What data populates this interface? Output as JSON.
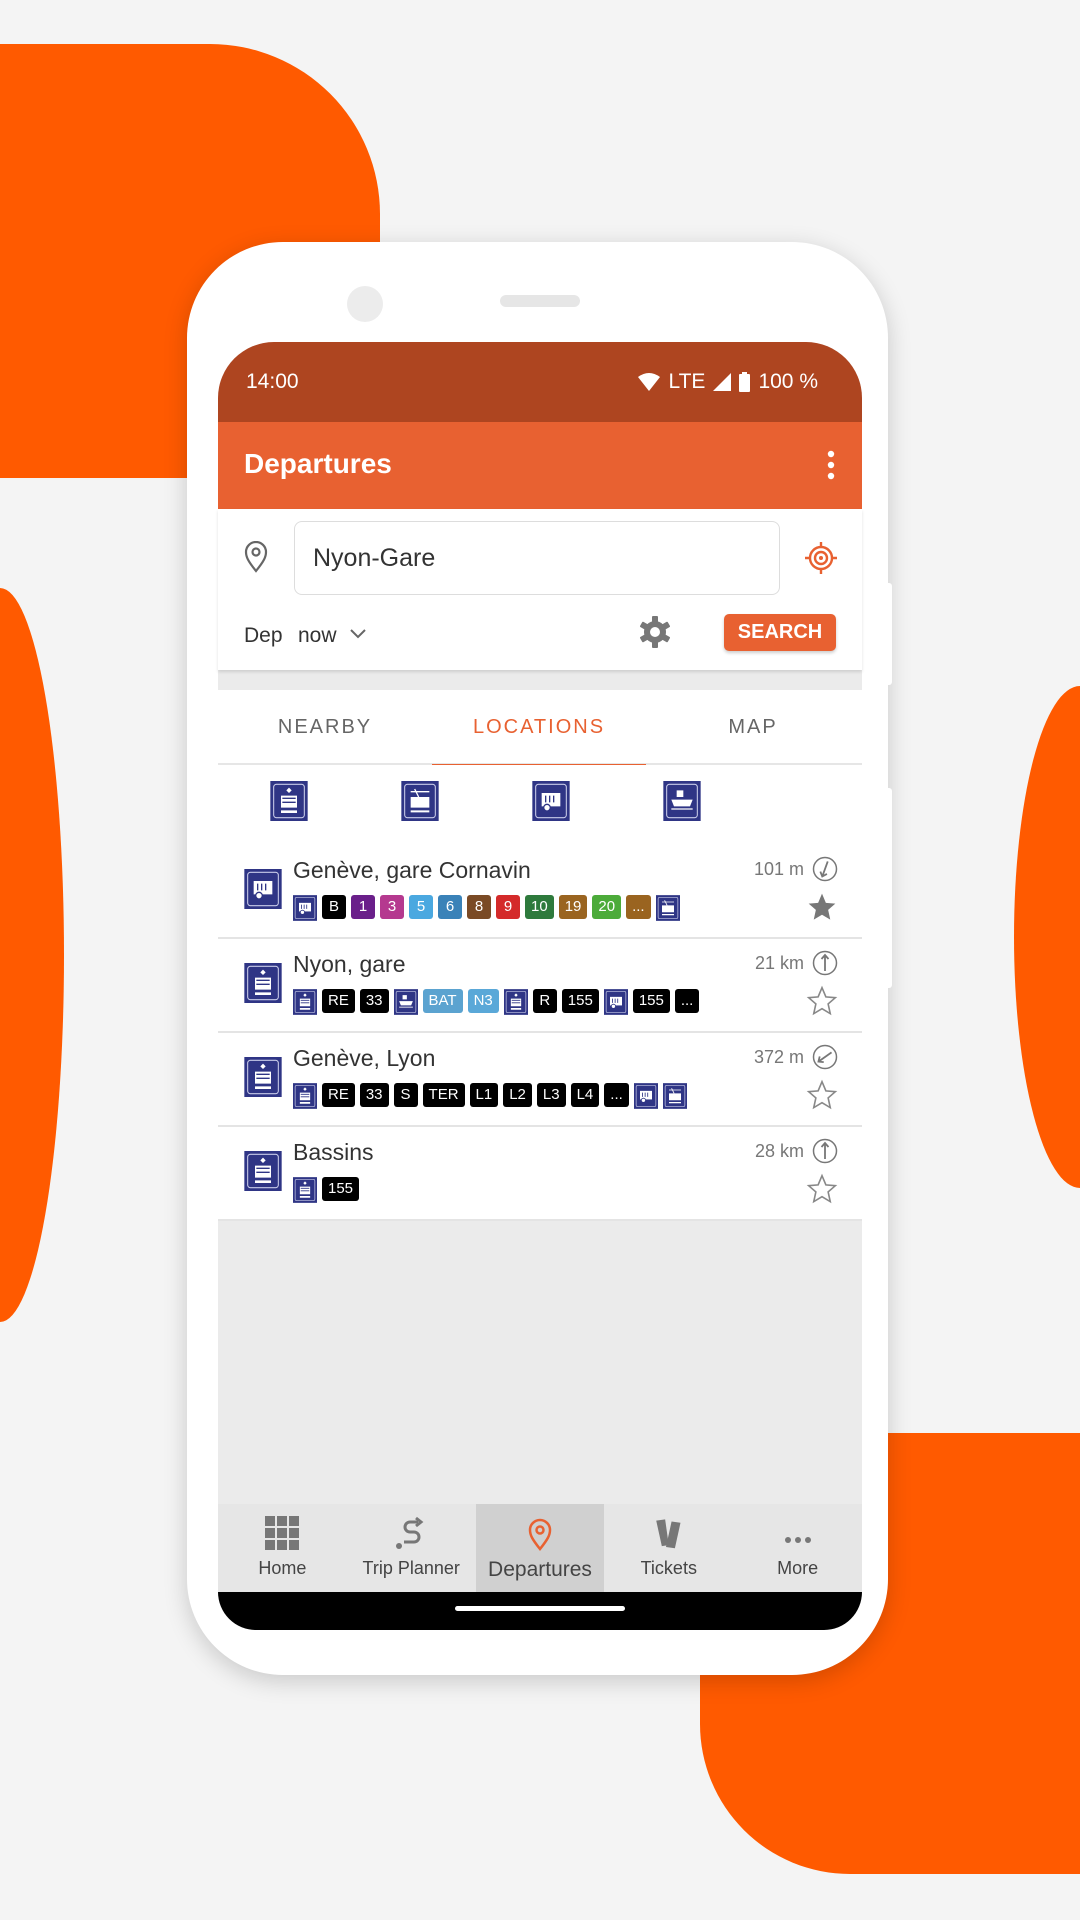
{
  "colors": {
    "brand": "#e86131",
    "status_bar": "#ae4520",
    "background_accent": "#ff5a00",
    "transit_icon": "#2f3585"
  },
  "status_bar": {
    "time": "14:00",
    "network": "LTE",
    "battery": "100 %"
  },
  "app_bar": {
    "title": "Departures"
  },
  "search": {
    "location_value": "Nyon-Gare",
    "dep_label": "Dep",
    "time_value": "now",
    "search_label": "SEARCH"
  },
  "tabs": [
    {
      "label": "NEARBY"
    },
    {
      "label": "LOCATIONS",
      "active": true
    },
    {
      "label": "MAP"
    }
  ],
  "filters": [
    {
      "icon": "train"
    },
    {
      "icon": "tram"
    },
    {
      "icon": "bus"
    },
    {
      "icon": "boat"
    }
  ],
  "locations": [
    {
      "icon": "bus",
      "name": "Genève, gare Cornavin",
      "distance": "101 m",
      "bearing_deg": 200,
      "favorite": true,
      "badges": [
        {
          "icon": "bus"
        },
        {
          "text": "B",
          "color": "#000000"
        },
        {
          "text": "1",
          "color": "#6a1f8a"
        },
        {
          "text": "3",
          "color": "#b5398f"
        },
        {
          "text": "5",
          "color": "#4aa8e0"
        },
        {
          "text": "6",
          "color": "#3a82b8"
        },
        {
          "text": "8",
          "color": "#7a4a25"
        },
        {
          "text": "9",
          "color": "#d42a2a"
        },
        {
          "text": "10",
          "color": "#2e7a3c"
        },
        {
          "text": "19",
          "color": "#9a6420"
        },
        {
          "text": "20",
          "color": "#4cab3a"
        },
        {
          "text": "...",
          "color": "#9a6420"
        },
        {
          "icon": "tram"
        }
      ]
    },
    {
      "icon": "train",
      "name": "Nyon, gare",
      "distance": "21 km",
      "bearing_deg": 0,
      "favorite": false,
      "badges": [
        {
          "icon": "train"
        },
        {
          "text": "RE",
          "color": "#000000"
        },
        {
          "text": "33",
          "color": "#000000"
        },
        {
          "icon": "boat"
        },
        {
          "text": "BAT",
          "color": "#5ba3d0"
        },
        {
          "text": "N3",
          "color": "#5aa8d8"
        },
        {
          "icon": "train"
        },
        {
          "text": "R",
          "color": "#000000"
        },
        {
          "text": "155",
          "color": "#000000"
        },
        {
          "icon": "bus"
        },
        {
          "text": "155",
          "color": "#000000"
        },
        {
          "text": "...",
          "color": "#000000"
        }
      ]
    },
    {
      "icon": "train",
      "name": "Genève, Lyon",
      "distance": "372 m",
      "bearing_deg": 235,
      "favorite": false,
      "badges": [
        {
          "icon": "train"
        },
        {
          "text": "RE",
          "color": "#000000"
        },
        {
          "text": "33",
          "color": "#000000"
        },
        {
          "text": "S",
          "color": "#000000"
        },
        {
          "text": "TER",
          "color": "#000000"
        },
        {
          "text": "L1",
          "color": "#000000"
        },
        {
          "text": "L2",
          "color": "#000000"
        },
        {
          "text": "L3",
          "color": "#000000"
        },
        {
          "text": "L4",
          "color": "#000000"
        },
        {
          "text": "...",
          "color": "#000000"
        },
        {
          "icon": "bus"
        },
        {
          "icon": "tram"
        }
      ]
    },
    {
      "icon": "train",
      "name": "Bassins",
      "distance": "28 km",
      "bearing_deg": 0,
      "favorite": false,
      "badges": [
        {
          "icon": "train"
        },
        {
          "text": "155",
          "color": "#000000"
        }
      ]
    }
  ],
  "bottom_nav": [
    {
      "label": "Home",
      "icon": "grid"
    },
    {
      "label": "Trip Planner",
      "icon": "route"
    },
    {
      "label": "Departures",
      "icon": "location-pin",
      "active": true
    },
    {
      "label": "Tickets",
      "icon": "tickets"
    },
    {
      "label": "More",
      "icon": "more-dots"
    }
  ]
}
